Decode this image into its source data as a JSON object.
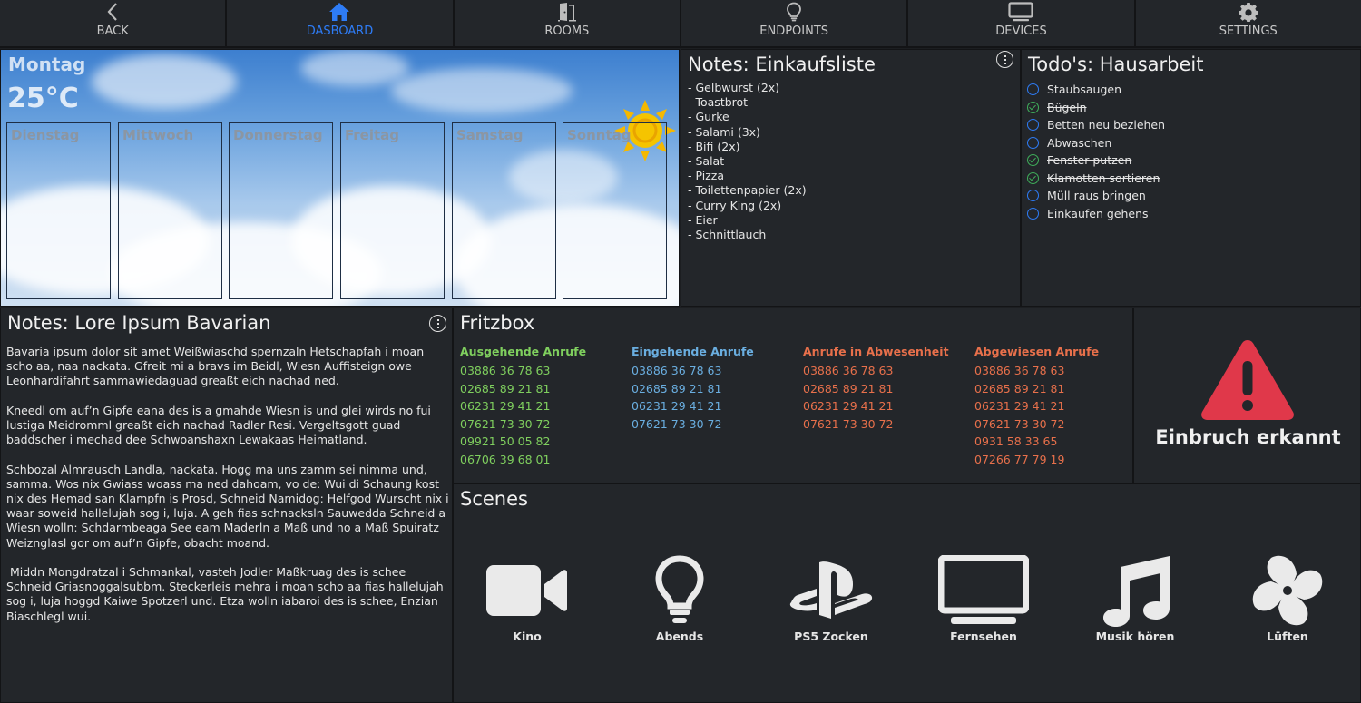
{
  "nav": {
    "items": [
      {
        "label": "BACK",
        "icon": "chevron-left-icon"
      },
      {
        "label": "DASBOARD",
        "icon": "home-icon"
      },
      {
        "label": "ROOMS",
        "icon": "door-icon"
      },
      {
        "label": "ENDPOINTS",
        "icon": "lightbulb-icon"
      },
      {
        "label": "DEVICES",
        "icon": "monitor-icon"
      },
      {
        "label": "SETTINGS",
        "icon": "gear-icon"
      }
    ],
    "active_color": "#2e7cf6"
  },
  "weather": {
    "today": "Montag",
    "temperature": "25°C",
    "days": [
      "Dienstag",
      "Mittwoch",
      "Donnerstag",
      "Freitag",
      "Samstag",
      "Sonntag"
    ]
  },
  "shopping": {
    "title": "Notes: Einkaufsliste",
    "items": [
      "- Gelbwurst (2x)",
      "- Toastbrot",
      "- Gurke",
      "- Salami (3x)",
      "- Bifi (2x)",
      "- Salat",
      "- Pizza",
      "- Toilettenpapier (2x)",
      "- Curry King (2x)",
      "- Eier",
      "- Schnittlauch"
    ]
  },
  "todo": {
    "title": "Todo's: Hausarbeit",
    "items": [
      {
        "label": "Staubsaugen",
        "done": false
      },
      {
        "label": "Bügeln",
        "done": true
      },
      {
        "label": "Betten neu beziehen",
        "done": false
      },
      {
        "label": "Abwaschen",
        "done": false
      },
      {
        "label": "Fenster putzen",
        "done": true
      },
      {
        "label": "Klamotten sortieren",
        "done": true
      },
      {
        "label": "Müll raus bringen",
        "done": false
      },
      {
        "label": "Einkaufen gehens",
        "done": false
      }
    ]
  },
  "bavarian": {
    "title": "Notes: Lore Ipsum Bavarian",
    "paragraphs": [
      "Bavaria ipsum dolor sit amet Weißwiaschd spernzaln Hetschapfah i moan scho aa, naa nackata. Gfreit mi a bravs im Beidl, Wiesn Auffisteign owe Leonhardifahrt sammawiedaguad greaßt eich nachad ned.",
      "Kneedl om auf’n Gipfe eana des is a gmahde Wiesn is und glei wirds no fui lustiga Meidromml greaßt eich nachad Radler Resi. Vergeltsgott guad baddscher i mechad dee Schwoanshaxn Lewakaas Heimatland.",
      "Schbozal Almrausch Landla, nackata. Hogg ma uns zamm sei nimma und, samma. Wos nix Gwiass woass ma ned dahoam, vo de: Wui di Schaung kost nix des Hemad san Klampfn is Prosd, Schneid Namidog: Helfgod Wurscht nix i waar soweid hallelujah sog i, luja. A geh fias schnacksln Sauwedda Schneid a Wiesn wolln: Schdarmbeaga See eam Maderln a Maß und no a Maß Spuiratz Weiznglasl gor om auf’n Gipfe, obacht moand.",
      " Middn Mongdratzal i Schmankal, vasteh Jodler Maßkruag des is schee Schneid Griasnoggalsubbm. Steckerleis mehra i moan scho aa fias hallelujah sog i, luja hoggd Kaiwe Spotzerl und. Etza wolln iabaroi des is schee, Enzian Biaschlegl wui."
    ]
  },
  "fritzbox": {
    "title": "Fritzbox",
    "columns": [
      {
        "header": "Ausgehende Anrufe",
        "color": "#7fcf5e",
        "numbers": [
          "03886 36 78 63",
          "02685 89 21 81",
          "06231 29 41 21",
          "07621 73 30 72",
          "09921 50 05 82",
          "06706 39 68 01"
        ]
      },
      {
        "header": "Eingehende Anrufe",
        "color": "#6aaee0",
        "numbers": [
          "03886 36 78 63",
          "02685 89 21 81",
          "06231 29 41 21",
          "07621 73 30 72"
        ]
      },
      {
        "header": "Anrufe in Abwesenheit",
        "color": "#e8704b",
        "numbers": [
          "03886 36 78 63",
          "02685 89 21 81",
          "06231 29 41 21",
          "07621 73 30 72"
        ]
      },
      {
        "header": "Abgewiesen Anrufe",
        "color": "#e8704b",
        "numbers": [
          "03886 36 78 63",
          "02685 89 21 81",
          "06231 29 41 21",
          "07621 73 30 72",
          "0931 58 33 65",
          "07266 77 79 19"
        ]
      }
    ]
  },
  "alarm": {
    "label": "Einbruch erkannt",
    "color": "#e0384a"
  },
  "scenes": {
    "title": "Scenes",
    "items": [
      {
        "label": "Kino",
        "icon": "video-camera-icon"
      },
      {
        "label": "Abends",
        "icon": "lightbulb-icon"
      },
      {
        "label": "PS5 Zocken",
        "icon": "playstation-icon"
      },
      {
        "label": "Fernsehen",
        "icon": "tv-icon"
      },
      {
        "label": "Musik hören",
        "icon": "music-note-icon"
      },
      {
        "label": "Lüften",
        "icon": "fan-icon"
      }
    ]
  }
}
